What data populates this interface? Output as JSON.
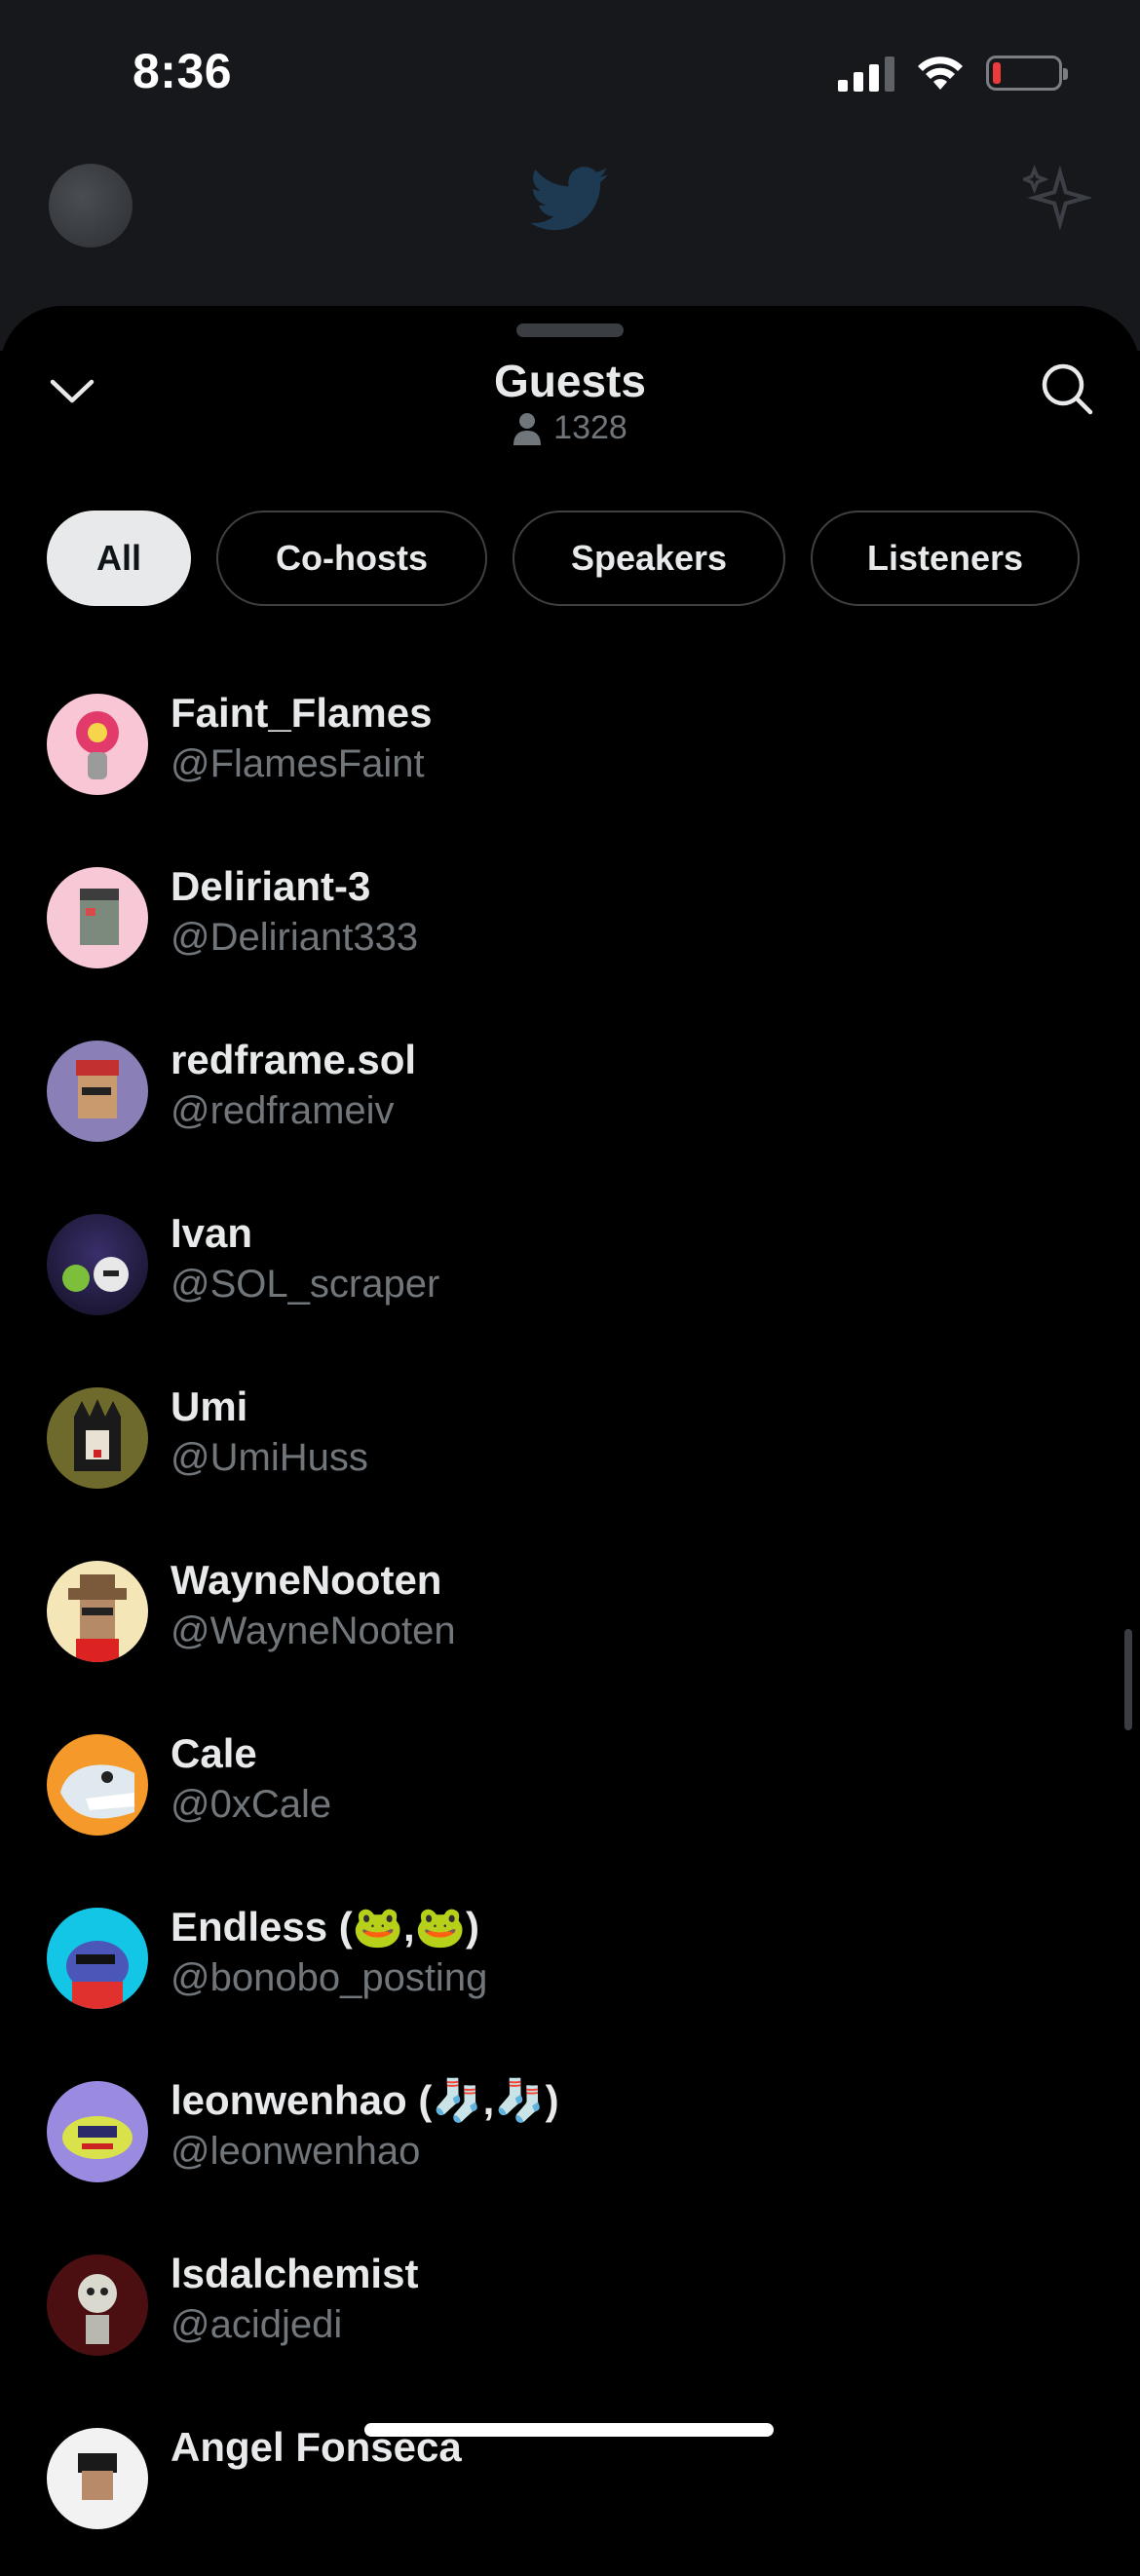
{
  "status_bar": {
    "time": "8:36"
  },
  "header": {
    "title": "Guests",
    "count": "1328"
  },
  "tabs": [
    {
      "label": "All",
      "active": true
    },
    {
      "label": "Co-hosts",
      "active": false
    },
    {
      "label": "Speakers",
      "active": false
    },
    {
      "label": "Listeners",
      "active": false
    }
  ],
  "guests": [
    {
      "name": "Faint_Flames",
      "handle": "@FlamesFaint"
    },
    {
      "name": "Deliriant-3",
      "handle": "@Deliriant333"
    },
    {
      "name": "redframe.sol",
      "handle": "@redframeiv"
    },
    {
      "name": "Ivan",
      "handle": "@SOL_scraper"
    },
    {
      "name": "Umi",
      "handle": "@UmiHuss"
    },
    {
      "name": "WayneNooten",
      "handle": "@WayneNooten"
    },
    {
      "name": "Cale",
      "handle": "@0xCale"
    },
    {
      "name": "Endless (🐸,🐸)",
      "handle": "@bonobo_posting"
    },
    {
      "name": "leonwenhao (🧦,🧦)",
      "handle": "@leonwenhao"
    },
    {
      "name": "lsdalchemist",
      "handle": "@acidjedi"
    },
    {
      "name": "Angel Fonseca",
      "handle": ""
    }
  ],
  "colors": {
    "background": "#000000",
    "text_primary": "#e7e9ea",
    "text_secondary": "#71767b",
    "tab_active_bg": "#e7e9ea"
  },
  "icons": {
    "collapse": "chevron-down-icon",
    "search": "search-icon",
    "listener_count": "person-icon"
  }
}
